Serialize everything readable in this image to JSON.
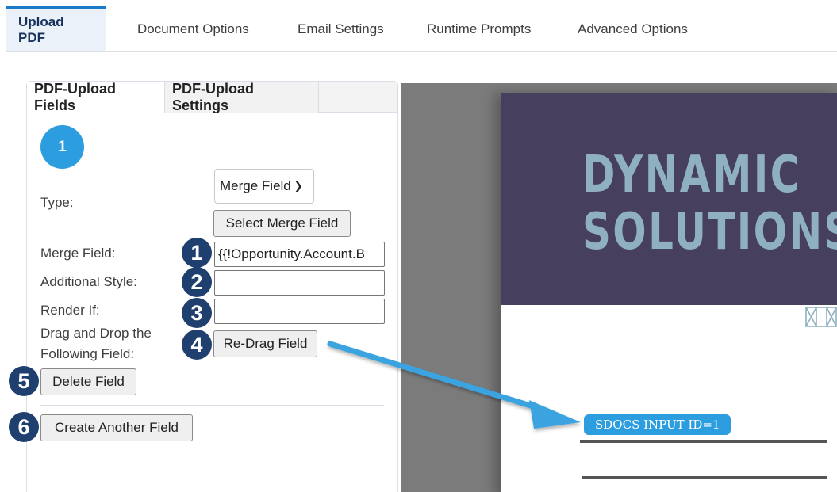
{
  "top_tabs": [
    "Upload PDF",
    "Document Options",
    "Email Settings",
    "Runtime Prompts",
    "Advanced Options"
  ],
  "panel": {
    "tabs": [
      "PDF-Upload Fields",
      "PDF-Upload Settings"
    ],
    "step_number": "1",
    "type_label": "Type:",
    "type_select_value": "Merge Field",
    "select_merge_field_button": "Select Merge Field",
    "merge_field_label": "Merge Field:",
    "merge_field_value": "{{!Opportunity.Account.B",
    "additional_style_label": "Additional Style:",
    "additional_style_value": "",
    "render_if_label": "Render If:",
    "render_if_value": "",
    "drag_label_line1": "Drag and Drop the",
    "drag_label_line2": "Following Field:",
    "redrag_button": "Re-Drag Field",
    "delete_button": "Delete Field",
    "create_button": "Create Another Field"
  },
  "callouts": [
    "1",
    "2",
    "3",
    "4",
    "5",
    "6"
  ],
  "preview": {
    "brand_line1": "DYNAMIC",
    "brand_line2": "SOLUTIONS",
    "input_tag": "SDOCS INPUT ID=1"
  },
  "colors": {
    "accent_blue": "#2c9ee0",
    "callout_navy": "#1f3f6e",
    "banner": "#463f5e",
    "brand_text": "#8fb0c0"
  }
}
